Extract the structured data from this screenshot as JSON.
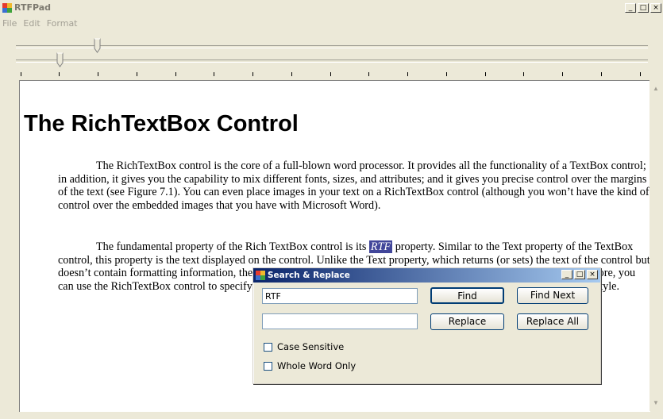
{
  "window": {
    "title": "RTFPad",
    "min_glyph": "_",
    "max_glyph": "□",
    "close_glyph": "×"
  },
  "menu": {
    "items": [
      "File",
      "Edit",
      "Format"
    ]
  },
  "sliders": {
    "first_value": 0.13,
    "second_value": 0.07
  },
  "document": {
    "heading": "The RichTextBox Control",
    "p1": "The RichTextBox control is the core of a full-blown word processor. It provides all the functionality of a TextBox control; in addition, it gives you the capability to mix different fonts, sizes, and attributes; and it gives you precise control over the margins of the text (see Figure 7.1). You can even place images in your text on a RichTextBox control (although you won’t have the kind of control over the embedded images that you have with Microsoft Word).",
    "p2_before": "The fundamental property of the Rich TextBox control is its ",
    "p2_highlight": "RTF",
    "p2_after": " property. Similar to the Text property of the TextBox control, this property is the text displayed on the control. Unlike the Text property, which returns (or sets) the text of the control but doesn’t contain formatting information, the RTF property returns the text along with any formatting information. Therefore, you can use the RichTextBox control to specify the text’s formatting including paragraph indentation, font, and font size or style."
  },
  "dialog": {
    "title": "Search & Replace",
    "min_glyph": "_",
    "max_glyph": "□",
    "close_glyph": "×",
    "search_value": "RTF",
    "replace_value": "",
    "find_label": "Find",
    "find_next_label": "Find Next",
    "replace_label": "Replace",
    "replace_all_label": "Replace All",
    "case_sensitive_label": "Case Sensitive",
    "whole_word_label": "Whole Word Only"
  },
  "colors": {
    "titlebar_active": "#0a246a",
    "highlight": "#41469a"
  }
}
